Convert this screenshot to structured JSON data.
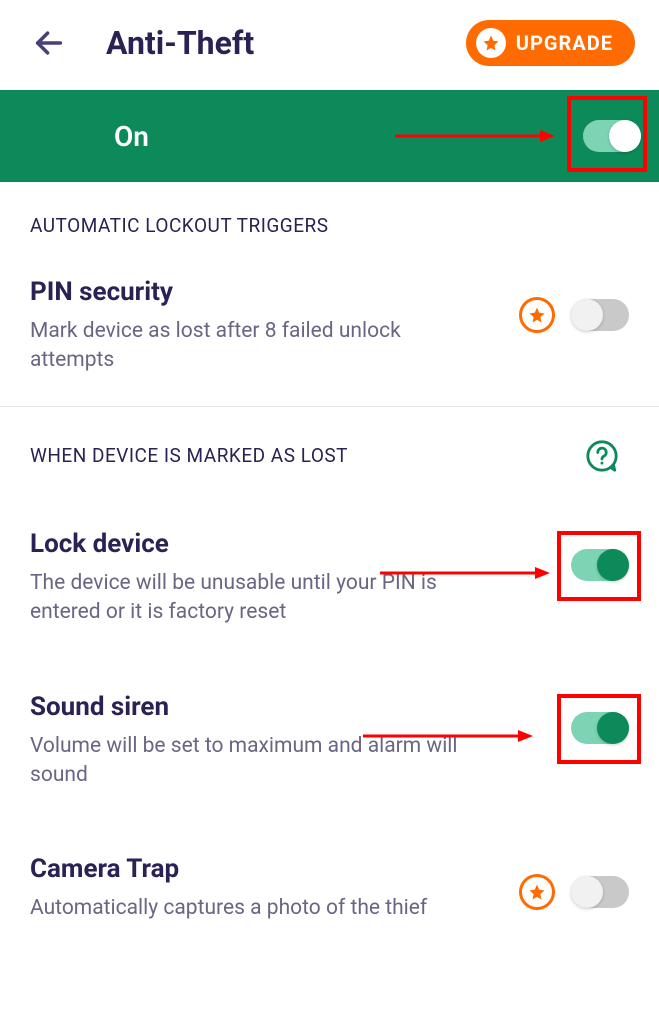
{
  "header": {
    "title": "Anti-Theft",
    "upgrade_label": "UPGRADE"
  },
  "master": {
    "status_label": "On",
    "enabled": true
  },
  "sections": {
    "triggers_header": "AUTOMATIC LOCKOUT TRIGGERS",
    "lost_header": "WHEN DEVICE IS MARKED AS LOST"
  },
  "settings": {
    "pin_security": {
      "title": "PIN security",
      "desc": "Mark device as lost after 8 failed unlock attempts",
      "premium": true,
      "enabled": false
    },
    "lock_device": {
      "title": "Lock device",
      "desc": "The device will be unusable until your PIN is entered or it is factory reset",
      "premium": false,
      "enabled": true
    },
    "sound_siren": {
      "title": "Sound siren",
      "desc": "Volume will be set to maximum and alarm will sound",
      "premium": false,
      "enabled": true
    },
    "camera_trap": {
      "title": "Camera Trap",
      "desc": "Automatically captures a photo of the thief",
      "premium": true,
      "enabled": false
    }
  },
  "colors": {
    "brand_green": "#0c8a5a",
    "brand_orange": "#ff6b00",
    "text_primary": "#2a2254",
    "text_secondary": "#6b6585",
    "annotation_red": "#ff0000"
  }
}
